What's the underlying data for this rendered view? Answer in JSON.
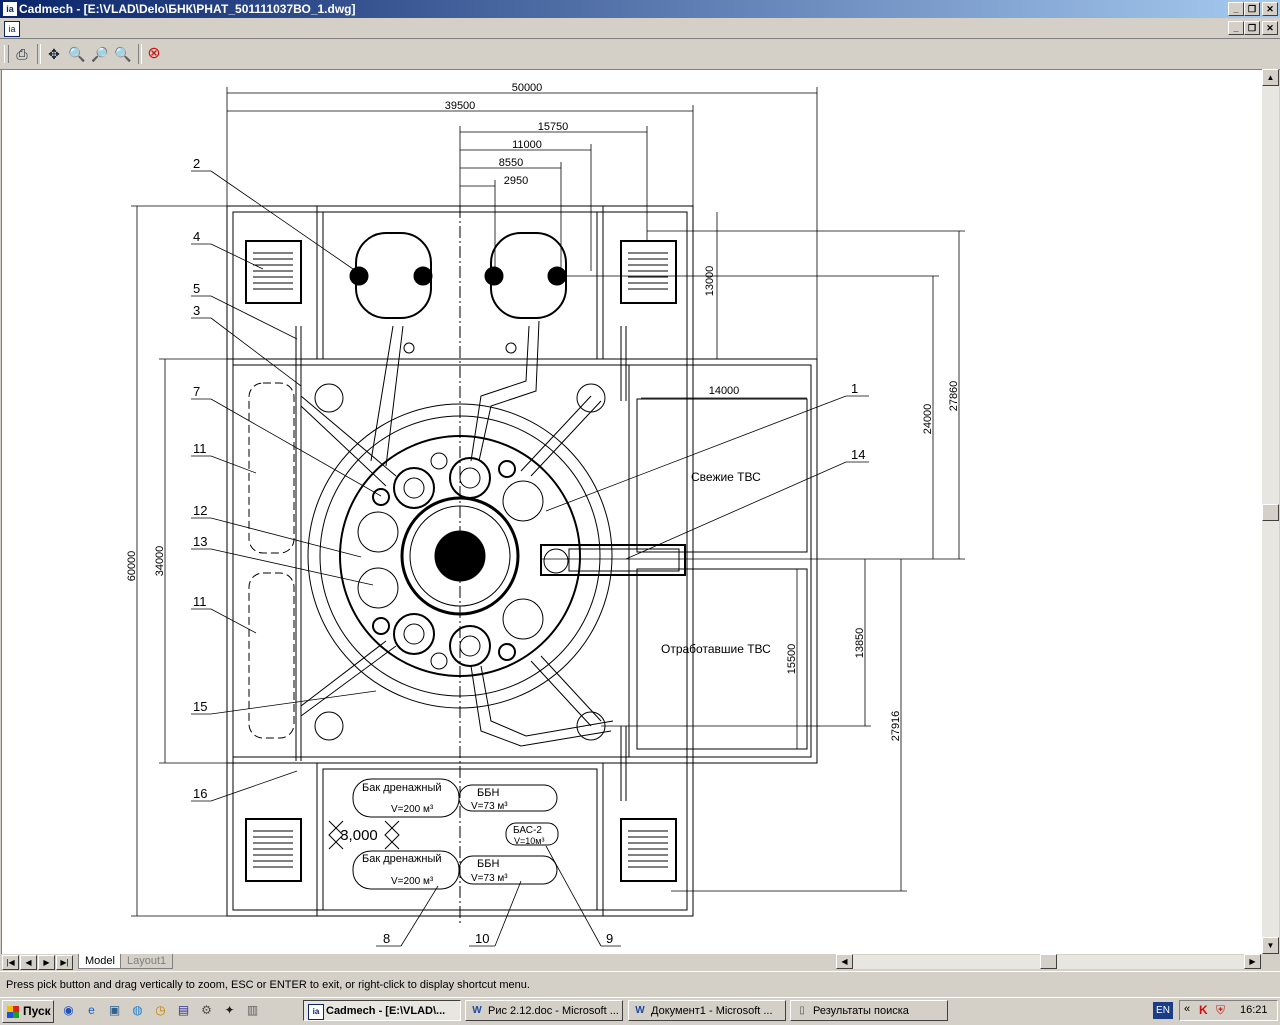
{
  "window": {
    "app_icon": "cadmech-icon",
    "title": "Cadmech - [E:\\VLAD\\Delo\\БНК\\РНАТ_501111037ВО_1.dwg]"
  },
  "toolbar": {
    "icons": [
      "print-icon",
      "pan-icon",
      "zoom-realtime-icon",
      "zoom-window-icon",
      "zoom-previous-icon",
      "close-view-icon"
    ]
  },
  "drawing": {
    "dimensions": {
      "d50000": "50000",
      "d39500": "39500",
      "d15750": "15750",
      "d11000": "11000",
      "d8550": "8550",
      "d2950": "2950",
      "d13000": "13000",
      "d14000": "14000",
      "d24000": "24000",
      "d27860": "27860",
      "d60000": "60000",
      "d34000": "34000",
      "d15500": "15500",
      "d13850": "13850",
      "d27916": "27916",
      "d3000": "3,000"
    },
    "callouts": [
      "1",
      "2",
      "3",
      "4",
      "5",
      "7",
      "8",
      "9",
      "10",
      "11",
      "11",
      "12",
      "13",
      "14",
      "15",
      "16"
    ],
    "labels": {
      "fresh_fuel": "Свежие ТВС",
      "spent_fuel": "Отработавшие ТВС",
      "drain_tank_1": "Бак дренажный",
      "drain_tank_1_vol": "V=200 м³",
      "drain_tank_2": "Бак дренажный",
      "drain_tank_2_vol": "V=200 м³",
      "bbn_1": "ББН",
      "bbn_1_vol": "V=73 м³",
      "bbn_2": "ББН",
      "bbn_2_vol": "V=73 м³",
      "bas": "БАС-2",
      "bas_vol": "V=10м³"
    }
  },
  "tabs": [
    "Model",
    "Layout1"
  ],
  "status": {
    "prompt": "Press pick button and drag vertically to zoom, ESC or ENTER to exit, or right-click to display shortcut menu."
  },
  "taskbar": {
    "start": "Пуск",
    "buttons": [
      "Cadmech - [E:\\VLAD\\...",
      "Рис 2.12.doc - Microsoft ...",
      "Документ1 - Microsoft ...",
      "Результаты поиска"
    ],
    "language": "EN",
    "time": "16:21"
  }
}
